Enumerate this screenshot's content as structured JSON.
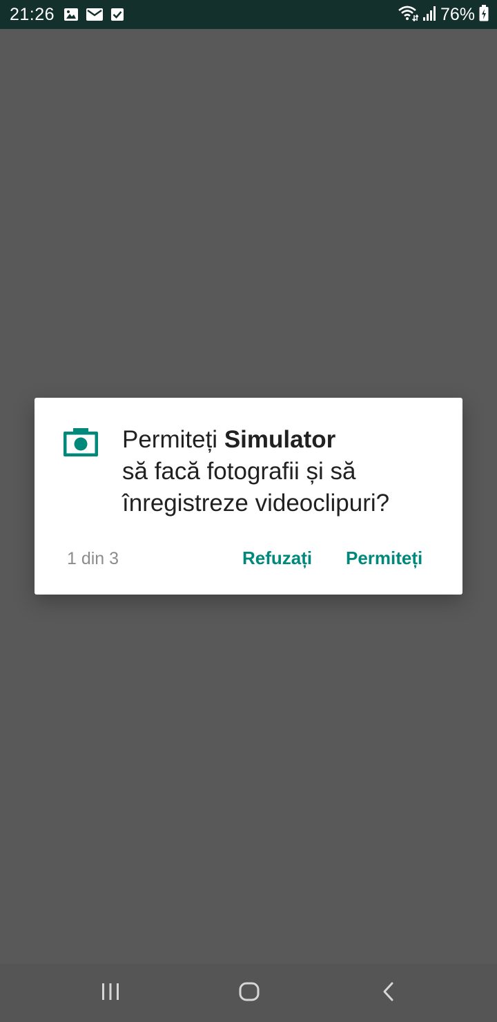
{
  "status_bar": {
    "time": "21:26",
    "left_icons": [
      "image-icon",
      "mail-icon",
      "checkbox-icon"
    ],
    "right_icons": [
      "wifi-icon",
      "signal-icon",
      "battery-charging-icon"
    ],
    "battery": "76%"
  },
  "dialog": {
    "message_prefix": "Permiteți ",
    "app_name": "Simulator",
    "message_suffix": "să facă fotografii și să înregistreze videoclipuri?",
    "counter": "1 din 3",
    "deny_label": "Refuzați",
    "allow_label": "Permiteți",
    "icon": "camera-icon",
    "accent_color": "#00897b"
  },
  "nav_bar": {
    "buttons": [
      "recents-icon",
      "home-icon",
      "back-icon"
    ]
  },
  "colors": {
    "status_bar": "#13302d",
    "scrim": "#595959",
    "nav_bar": "#555555"
  }
}
